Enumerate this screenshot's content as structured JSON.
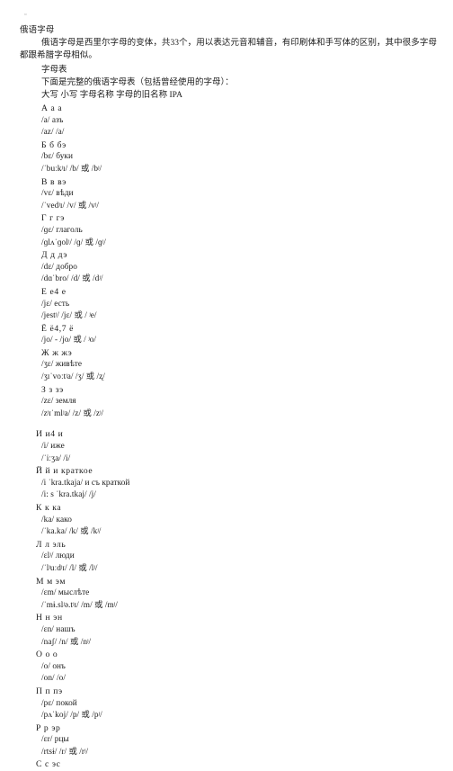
{
  "page": {
    "tofu_glyph": "▫",
    "title": "俄语字母",
    "intro": "俄语字母是西里尔字母的变体，共33个，用以表达元音和辅音，有印刷体和手写体的区别，其中很多字母都跟希腊字母相似。",
    "section_head": "字母表",
    "section_note": "下面是完整的俄语字母表（包括曾经使用的字母）：",
    "column_header": "大写 小写 字母名称 字母的旧名称 IPA"
  },
  "letters": [
    {
      "letters_line": "А а а",
      "name_line": "/a/ азъ",
      "ipa_line": "/az/ /a/",
      "shift": false
    },
    {
      "letters_line": "Б б бэ",
      "name_line": "/bɛ/ буки",
      "ipa_line": "/ˈbuːkʲɪ/ /b/ 或 /bʲ/",
      "shift": false
    },
    {
      "letters_line": "В в вэ",
      "name_line": "/vɛ/ вѣди",
      "ipa_line": "/ˈvedʲɪ/ /v/ 或 /vʲ/",
      "shift": false
    },
    {
      "letters_line": "Г г гэ",
      "name_line": "/ɡɛ/ глаголь",
      "ipa_line": "/ɡlʌˈɡolʲ/ /ɡ/ 或 /ɡʲ/",
      "shift": false
    },
    {
      "letters_line": "Д д дэ",
      "name_line": "/dɛ/ добро",
      "ipa_line": "/dɑˈbro/ /d/ 或 /dʲ/",
      "shift": false
    },
    {
      "letters_line": "Е е4 е",
      "letters_sup": "4",
      "name_line": "/jɛ/ есть",
      "ipa_line": "/jestʲ/ /jɛ/ 或 / ʲe/",
      "shift": false
    },
    {
      "letters_line": "Ё ё4,7 ё",
      "letters_sup": "4,7",
      "name_line": "/jo/ - /jo/ 或 / ʲo/",
      "ipa_line": "",
      "shift": false
    },
    {
      "letters_line": "Ж ж жэ",
      "name_line": "/ʒɛ/ живѣте",
      "ipa_line": "/ʒɪˈvoːtʲa/ /ʒ/ 或 /ʐ/",
      "shift": false
    },
    {
      "letters_line": "З з зэ",
      "name_line": "/zɛ/ земля",
      "ipa_line": "/zʲɪˈmlʲa/ /z/ 或 /zʲ/",
      "shift": false
    },
    {
      "letters_line": "И и4 и",
      "letters_sup": "4",
      "name_line": "/i/ иже",
      "ipa_line": "/ˈiːʒa/ /i/",
      "shift": true
    },
    {
      "letters_line": "Й й и краткое",
      "name_line": "/i ˈkra.tkaja/ и съ краткой",
      "ipa_line": "/i: s ˈkra.tkaj/ /j/",
      "shift": true
    },
    {
      "letters_line": "К к ка",
      "name_line": "/ka/ како",
      "ipa_line": "/ˈka.ka/ /k/ 或 /kʲ/",
      "shift": true
    },
    {
      "letters_line": "Л л эль",
      "name_line": "/ɛlʲ/ люди",
      "ipa_line": "/ˈlʲuːdʲɪ/ /l/ 或 /lʲ/",
      "shift": true
    },
    {
      "letters_line": "М м эм",
      "name_line": "/ɛm/ мыслѣте",
      "ipa_line": "/ˈmɨ.slʲə.tʲɪ/ /m/ 或 /mʲ/",
      "shift": true
    },
    {
      "letters_line": "Н н эн",
      "name_line": "/ɛn/ нашъ",
      "ipa_line": "/naʃ/ /n/ 或 /nʲ/",
      "shift": true
    },
    {
      "letters_line": "О о о",
      "name_line": "/o/ онъ",
      "ipa_line": "/on/ /o/",
      "shift": true
    },
    {
      "letters_line": "П п пэ",
      "name_line": "/pɛ/ покой",
      "ipa_line": "/pʌˈkoj/ /p/ 或 /pʲ/",
      "shift": true
    },
    {
      "letters_line": "Р р эр",
      "name_line": "/ɛr/ рцы",
      "ipa_line": "/rtsɨ/ /r/ 或 /rʲ/",
      "shift": true
    },
    {
      "letters_line": "С с эс",
      "name_line": "",
      "ipa_line": "",
      "shift": true
    }
  ]
}
